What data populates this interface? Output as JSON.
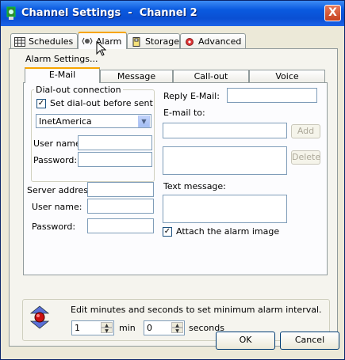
{
  "window": {
    "title": "Channel Settings  -  Channel 2",
    "close_label": "X"
  },
  "tabs": [
    {
      "label": "Schedules",
      "icon": "calendar-grid-icon"
    },
    {
      "label": "Alarm",
      "icon": "alarm-siren-icon"
    },
    {
      "label": "Storage",
      "icon": "storage-disk-icon"
    },
    {
      "label": "Advanced",
      "icon": "advanced-gear-icon"
    }
  ],
  "alarm": {
    "settings_label": "Alarm Settings...",
    "subtabs": [
      "E-Mail",
      "Message",
      "Call-out",
      "Voice"
    ],
    "dialout": {
      "group_label": "Dial-out connection",
      "checkbox_label": "Set dial-out before sent",
      "checked": true,
      "connection": "InetAmerica",
      "username_label": "User name:",
      "username_value": "",
      "password_label": "Password:",
      "password_value": ""
    },
    "server": {
      "address_label": "Server address:",
      "username_label": "User name:",
      "password_label": "Password:"
    },
    "reply_label": "Reply E-Mail:",
    "emailto_label": "E-mail to:",
    "add_label": "Add",
    "delete_label": "Delete",
    "text_message_label": "Text message:",
    "attach_label": "Attach the alarm image",
    "attach_checked": true
  },
  "interval": {
    "description": "Edit minutes and seconds to set minimum alarm interval.",
    "minutes_value": "1",
    "minutes_unit": "min",
    "seconds_value": "0",
    "seconds_unit": "seconds"
  },
  "footer": {
    "ok_label": "OK",
    "cancel_label": "Cancel"
  }
}
